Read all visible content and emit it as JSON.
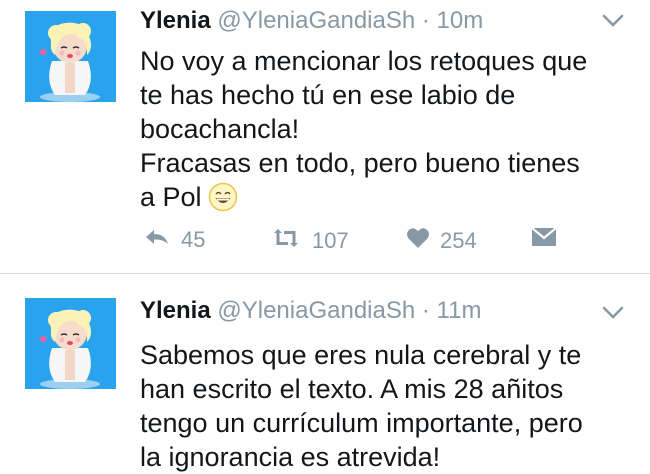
{
  "tweets": [
    {
      "name": "Ylenia",
      "handle": "@YleniaGandiaSh",
      "separator": "·",
      "time": "10m",
      "text_lines": [
        "No voy a mencionar los retoques que",
        "te has hecho tú en ese labio de",
        "bocachancla!",
        "Fracasas en todo, pero bueno tienes",
        "a Pol"
      ],
      "emoji": "grinning-face-emoji",
      "actions": {
        "reply_count": "45",
        "retweet_count": "107",
        "like_count": "254"
      }
    },
    {
      "name": "Ylenia",
      "handle": "@YleniaGandiaSh",
      "separator": "·",
      "time": "11m",
      "text_lines": [
        "Sabemos que eres nula cerebral y te",
        "han escrito el texto. A mis 28 añitos",
        "tengo un currículum importante, pero",
        "la ignorancia es atrevida!"
      ]
    }
  ],
  "icons": {
    "avatar": "marilyn-avatar",
    "menu": "chevron-down-icon",
    "reply": "reply-icon",
    "retweet": "retweet-icon",
    "like": "heart-icon",
    "dm": "direct-message-icon"
  },
  "colors": {
    "avatar_bg": "#2aa3ef",
    "muted": "#8899a6",
    "text": "#14171a",
    "divider": "#d6dbdf"
  }
}
